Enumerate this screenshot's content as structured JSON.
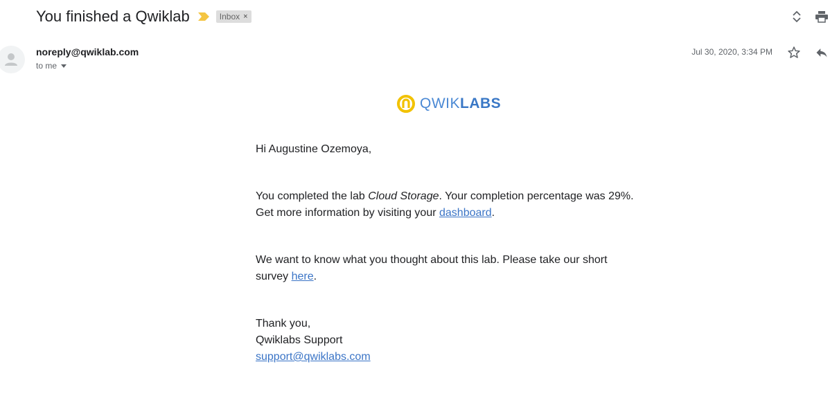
{
  "email": {
    "subject": "You finished a Qwiklab",
    "label": "Inbox",
    "label_remove": "×",
    "sender": "noreply@qwiklab.com",
    "to": "to me",
    "date": "Jul 30, 2020, 3:34 PM"
  },
  "icons": {
    "importance": "importance-marker-icon",
    "expand": "expand-collapse-icon",
    "print": "print-icon",
    "avatar": "person-icon",
    "star": "star-icon",
    "reply": "reply-icon",
    "caret": "caret-down-icon",
    "logo": "qwiklabs-logo-icon"
  },
  "colors": {
    "importance": "#f4c542",
    "logo_ring": "#f2c200",
    "logo_text": "#4a88d4",
    "link": "#3a74c6"
  },
  "logo": {
    "light": "QWIK",
    "bold": "LABS"
  },
  "body": {
    "greeting": "Hi Augustine Ozemoya,",
    "completed_pre": "You completed the lab ",
    "lab_name": "Cloud Storage",
    "completed_post": ". Your completion percentage was 29%.",
    "more_info_pre": "Get more information by visiting your ",
    "dashboard_link": "dashboard",
    "more_info_post": ".",
    "survey_line1": "We want to know what you thought about this lab. Please take our short",
    "survey_pre": "survey ",
    "survey_link": "here",
    "survey_post": ".",
    "thanks": "Thank you,",
    "signature": "Qwiklabs Support",
    "support_email": "support@qwiklabs.com"
  }
}
